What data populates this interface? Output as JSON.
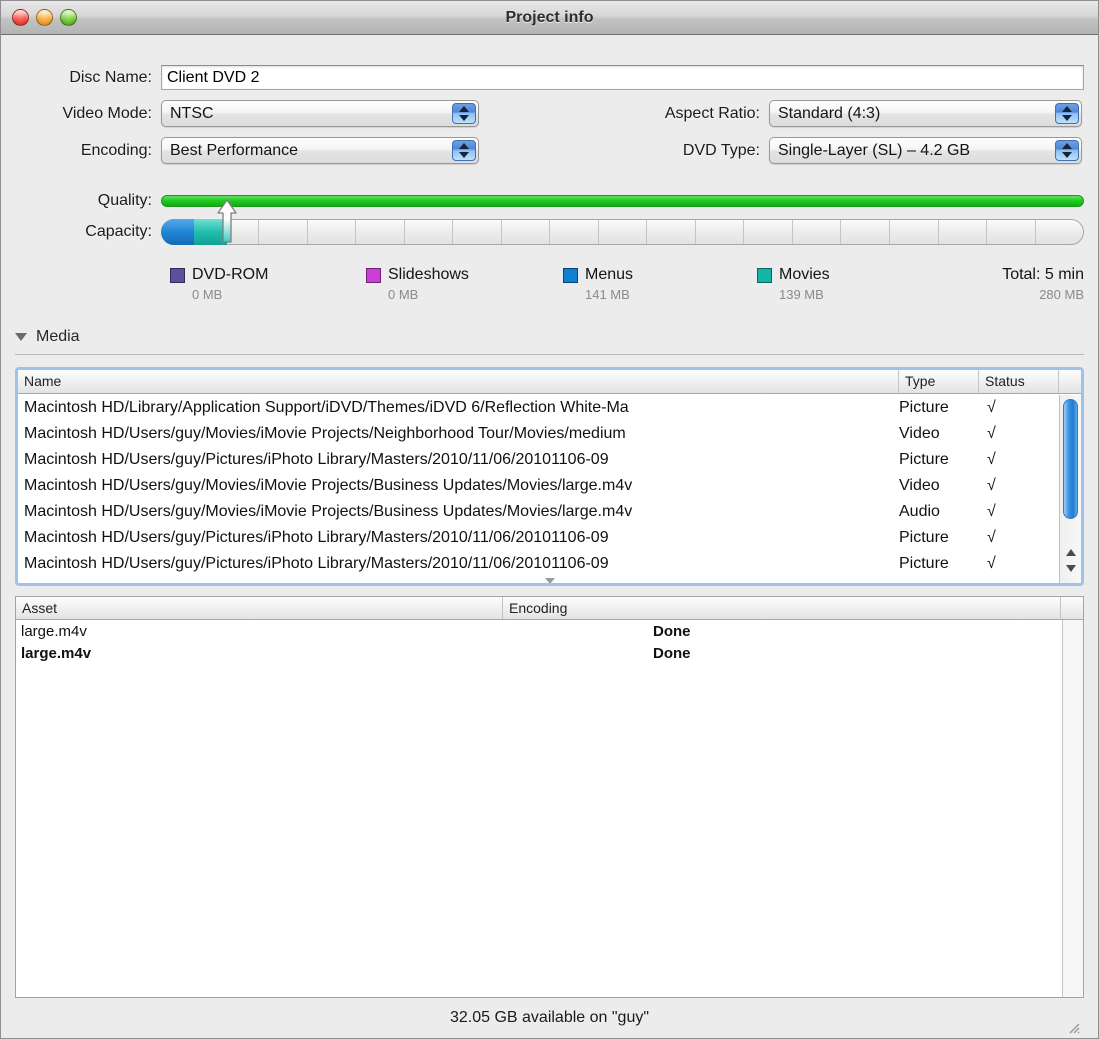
{
  "window": {
    "title": "Project info",
    "traffic_lights": [
      "close",
      "minimize",
      "zoom"
    ]
  },
  "form": {
    "disc_name_label": "Disc Name:",
    "disc_name_value": "Client DVD 2",
    "video_mode_label": "Video Mode:",
    "video_mode_value": "NTSC",
    "encoding_label": "Encoding:",
    "encoding_value": "Best Performance",
    "aspect_ratio_label": "Aspect Ratio:",
    "aspect_ratio_value": "Standard (4:3)",
    "dvd_type_label": "DVD Type:",
    "dvd_type_value": "Single-Layer (SL) – 4.2 GB"
  },
  "meters": {
    "quality_label": "Quality:",
    "quality_percent": 100,
    "capacity_label": "Capacity:",
    "capacity_menus_percent": 3.6,
    "capacity_movies_percent": 3.5,
    "capacity_marker_percent": 7.1,
    "capacity_ticks": 19
  },
  "legend": {
    "items": [
      {
        "name": "DVD-ROM",
        "size": "0 MB",
        "color": "#5f4f9e"
      },
      {
        "name": "Slideshows",
        "size": "0 MB",
        "color": "#cc3fd4"
      },
      {
        "name": "Menus",
        "size": "141 MB",
        "color": "#0f7fd1"
      },
      {
        "name": "Movies",
        "size": "139 MB",
        "color": "#14b5a7"
      }
    ],
    "total_label": "Total: 5 min",
    "total_size": "280 MB"
  },
  "media": {
    "section_label": "Media",
    "columns": [
      "Name",
      "Type",
      "Status"
    ],
    "rows": [
      {
        "name": "Macintosh HD/Library/Application Support/iDVD/Themes/iDVD 6/Reflection White-Ma",
        "type": "Picture",
        "status": "√"
      },
      {
        "name": "Macintosh HD/Users/guy/Movies/iMovie Projects/Neighborhood Tour/Movies/medium",
        "type": "Video",
        "status": "√"
      },
      {
        "name": "Macintosh HD/Users/guy/Pictures/iPhoto Library/Masters/2010/11/06/20101106-09",
        "type": "Picture",
        "status": "√"
      },
      {
        "name": "Macintosh HD/Users/guy/Movies/iMovie Projects/Business Updates/Movies/large.m4v",
        "type": "Video",
        "status": "√"
      },
      {
        "name": "Macintosh HD/Users/guy/Movies/iMovie Projects/Business Updates/Movies/large.m4v",
        "type": "Audio",
        "status": "√"
      },
      {
        "name": "Macintosh HD/Users/guy/Pictures/iPhoto Library/Masters/2010/11/06/20101106-09",
        "type": "Picture",
        "status": "√"
      },
      {
        "name": "Macintosh HD/Users/guy/Pictures/iPhoto Library/Masters/2010/11/06/20101106-09",
        "type": "Picture",
        "status": "√"
      }
    ]
  },
  "assets": {
    "columns": [
      "Asset",
      "Encoding"
    ],
    "rows": [
      {
        "asset": "large.m4v",
        "encoding": "Done",
        "bold": false
      },
      {
        "asset": "large.m4v",
        "encoding": "Done",
        "bold": true
      }
    ]
  },
  "footer": {
    "status": "32.05 GB available on \"guy\""
  }
}
